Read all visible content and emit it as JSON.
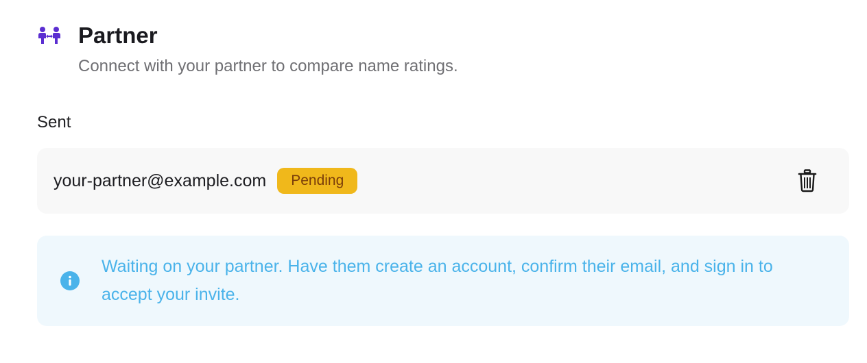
{
  "header": {
    "icon": "partner-link-icon",
    "title": "Partner",
    "subtitle": "Connect with your partner to compare name ratings."
  },
  "sent": {
    "label": "Sent",
    "invites": [
      {
        "email": "your-partner@example.com",
        "status": "Pending",
        "delete_icon": "trash-icon"
      }
    ]
  },
  "notice": {
    "icon": "info-icon",
    "text": "Waiting on your partner. Have them create an account, confirm their email, and sign in to accept your invite."
  },
  "colors": {
    "accent": "#5b2ed1",
    "badge_bg": "#f0b81b",
    "badge_text": "#7a3d0a",
    "info_bg": "#eff8fd",
    "info_text": "#4ab3ea"
  }
}
